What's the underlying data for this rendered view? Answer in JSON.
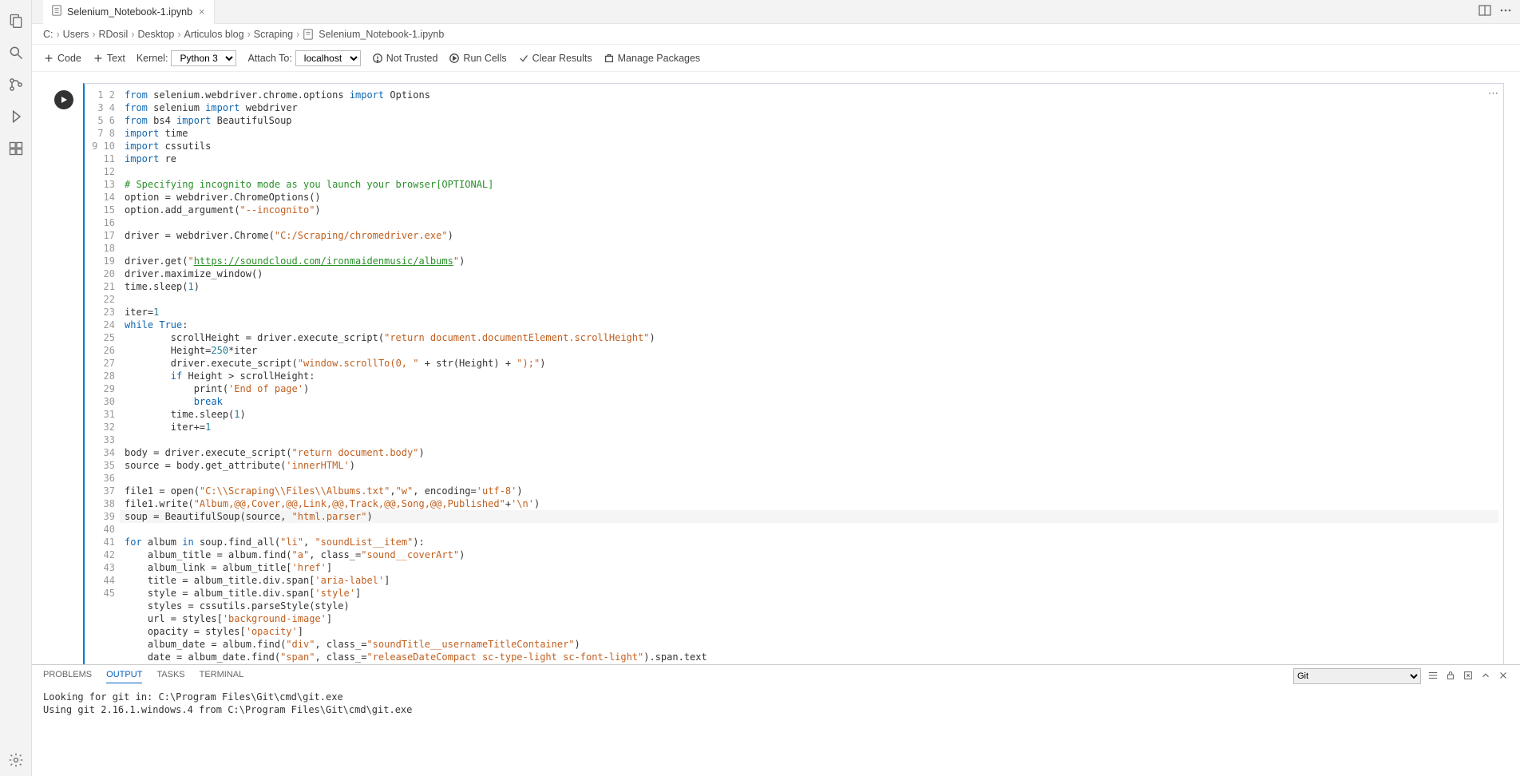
{
  "tab": {
    "title": "Selenium_Notebook-1.ipynb"
  },
  "breadcrumb": [
    "C:",
    "Users",
    "RDosil",
    "Desktop",
    "Articulos blog",
    "Scraping",
    "Selenium_Notebook-1.ipynb"
  ],
  "toolbar": {
    "code": "Code",
    "text": "Text",
    "kernel_label": "Kernel:",
    "kernel_value": "Python 3",
    "attach_label": "Attach To:",
    "attach_value": "localhost",
    "not_trusted": "Not Trusted",
    "run_cells": "Run Cells",
    "clear_results": "Clear Results",
    "manage_packages": "Manage Packages"
  },
  "code_lines": 45,
  "panel": {
    "tabs": {
      "problems": "PROBLEMS",
      "output": "OUTPUT",
      "tasks": "TASKS",
      "terminal": "TERMINAL"
    },
    "dropdown": "Git",
    "line1": "Looking for git in: C:\\Program Files\\Git\\cmd\\git.exe",
    "line2": "Using git 2.16.1.windows.4 from C:\\Program Files\\Git\\cmd\\git.exe"
  }
}
